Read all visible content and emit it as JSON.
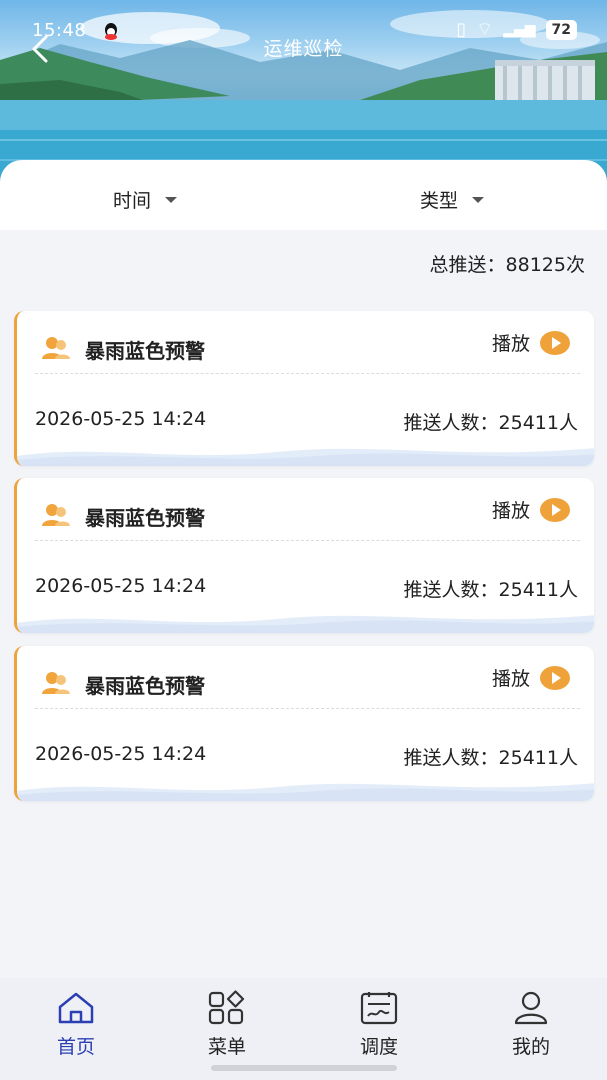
{
  "status_bar": {
    "time": "15:48",
    "battery": "72"
  },
  "header": {
    "title": "运维巡检"
  },
  "filters": {
    "time_label": "时间",
    "type_label": "类型"
  },
  "summary": {
    "total_label": "总推送：",
    "total_value": "88125次"
  },
  "cards": [
    {
      "title": "暴雨蓝色预警",
      "play_label": "播放",
      "datetime": "2026-05-25 14:24",
      "push_label": "推送人数：",
      "push_count": "25411人"
    },
    {
      "title": "暴雨蓝色预警",
      "play_label": "播放",
      "datetime": "2026-05-25 14:24",
      "push_label": "推送人数：",
      "push_count": "25411人"
    },
    {
      "title": "暴雨蓝色预警",
      "play_label": "播放",
      "datetime": "2026-05-25 14:24",
      "push_label": "推送人数：",
      "push_count": "25411人"
    }
  ],
  "bottom_nav": [
    {
      "label": "首页",
      "icon": "home-icon",
      "active": true
    },
    {
      "label": "菜单",
      "icon": "grid-icon",
      "active": false
    },
    {
      "label": "调度",
      "icon": "dispatch-icon",
      "active": false
    },
    {
      "label": "我的",
      "icon": "user-icon",
      "active": false
    }
  ],
  "colors": {
    "accent": "#f0a23a",
    "nav_active": "#2b3fb3",
    "background": "#f2f4f8"
  }
}
